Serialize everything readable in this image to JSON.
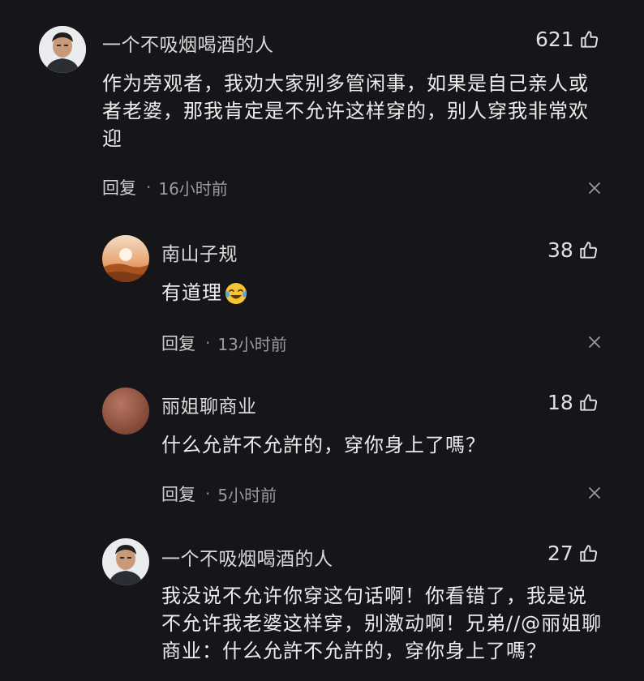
{
  "comments": [
    {
      "author": "一个不吸烟喝酒的人",
      "likes": "621",
      "text": "作为旁观者，我劝大家别多管闲事，如果是自己亲人或者老婆，那我肯定是不允许这样穿的，别人穿我非常欢迎",
      "reply_label": "回复",
      "time": "16小时前",
      "avatar": "person-photo"
    },
    {
      "author": "南山子规",
      "likes": "38",
      "text": "有道理",
      "emoji": "crying-laughing-emoji",
      "reply_label": "回复",
      "time": "13小时前",
      "avatar": "desert-sunset"
    },
    {
      "author": "丽姐聊商业",
      "likes": "18",
      "text": "什么允許不允許的，穿你身上了嗎？",
      "reply_label": "回复",
      "time": "5小时前",
      "avatar": "brown-circle"
    },
    {
      "author": "一个不吸烟喝酒的人",
      "likes": "27",
      "text": "我没说不允许你穿这句话啊！你看错了，我是说不允许我老婆这样穿，别激动啊！兄弟//@丽姐聊商业：什么允許不允許的，穿你身上了嗎？",
      "avatar": "person-photo"
    }
  ],
  "icons": {
    "like": "thumbs-up-icon",
    "dismiss": "close-icon"
  },
  "colors": {
    "background": "#16161a",
    "text": "#ececec",
    "meta": "#9b9b9b"
  }
}
